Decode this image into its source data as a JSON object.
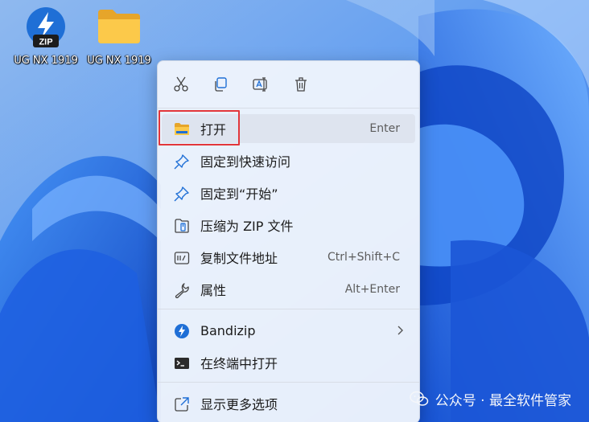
{
  "desktop": {
    "icons": [
      {
        "label": "UG NX 1919",
        "icon": "bandizip-zip-archive-icon"
      },
      {
        "label": "UG NX 1919",
        "icon": "folder-icon"
      }
    ]
  },
  "context_menu": {
    "toolbar": [
      {
        "name": "cut",
        "icon": "scissors-icon"
      },
      {
        "name": "copy",
        "icon": "copy-icon"
      },
      {
        "name": "rename",
        "icon": "rename-icon"
      },
      {
        "name": "delete",
        "icon": "trash-icon"
      }
    ],
    "items": [
      {
        "label": "打开",
        "shortcut": "Enter",
        "icon": "folder-open-icon"
      },
      {
        "label": "固定到快速访问",
        "shortcut": "",
        "icon": "pin-icon"
      },
      {
        "label": "固定到“开始”",
        "shortcut": "",
        "icon": "pin-icon"
      },
      {
        "label": "压缩为 ZIP 文件",
        "shortcut": "",
        "icon": "zip-compress-icon"
      },
      {
        "label": "复制文件地址",
        "shortcut": "Ctrl+Shift+C",
        "icon": "copy-path-icon"
      },
      {
        "label": "属性",
        "shortcut": "Alt+Enter",
        "icon": "wrench-icon"
      },
      {
        "label": "Bandizip",
        "shortcut": "",
        "icon": "bandizip-icon",
        "submenu": true
      },
      {
        "label": "在终端中打开",
        "shortcut": "",
        "icon": "terminal-icon"
      },
      {
        "label": "显示更多选项",
        "shortcut": "",
        "icon": "external-link-icon"
      }
    ],
    "highlighted_item": "打开"
  },
  "watermark": {
    "text": "公众号 · 最全软件管家"
  },
  "colors": {
    "accent": "#1f6fd6",
    "highlight_border": "#e2363a",
    "wallpaper": "#4f8fe8"
  }
}
